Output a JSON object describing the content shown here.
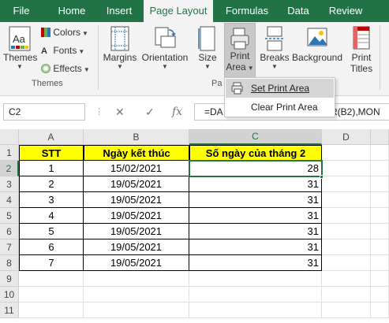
{
  "tabs": [
    "File",
    "Home",
    "Insert",
    "Page Layout",
    "Formulas",
    "Data",
    "Review"
  ],
  "active_tab": "Page Layout",
  "ribbon": {
    "themes": "Themes",
    "colors": "Colors",
    "fonts": "Fonts",
    "effects": "Effects",
    "themes_group": "Themes",
    "margins": "Margins",
    "orientation": "Orientation",
    "size": "Size",
    "print_area_line1": "Print",
    "print_area_line2": "Area",
    "breaks": "Breaks",
    "background": "Background",
    "print_titles_line1": "Print",
    "print_titles_line2": "Titles",
    "page_group_partial": "Pa"
  },
  "menu": {
    "set_print_area": "Set Print Area",
    "clear_print_area": "Clear Print Area"
  },
  "formula_bar": {
    "name_box": "C2",
    "formula_left": "=DA",
    "formula_right": "AR(B2),MON"
  },
  "sheet": {
    "columns": [
      "A",
      "B",
      "C",
      "D"
    ],
    "rows": [
      "1",
      "2",
      "3",
      "4",
      "5",
      "6",
      "7",
      "8",
      "9",
      "10",
      "11"
    ],
    "headers": [
      "STT",
      "Ngày kết thúc",
      "Số ngày của tháng 2"
    ],
    "data": [
      [
        "1",
        "15/02/2021",
        "28"
      ],
      [
        "2",
        "19/05/2021",
        "31"
      ],
      [
        "3",
        "19/05/2021",
        "31"
      ],
      [
        "4",
        "19/05/2021",
        "31"
      ],
      [
        "5",
        "19/05/2021",
        "31"
      ],
      [
        "6",
        "19/05/2021",
        "31"
      ],
      [
        "7",
        "19/05/2021",
        "31"
      ]
    ]
  },
  "colors": {
    "excel_green": "#217346",
    "header_fill": "#ffff00"
  }
}
